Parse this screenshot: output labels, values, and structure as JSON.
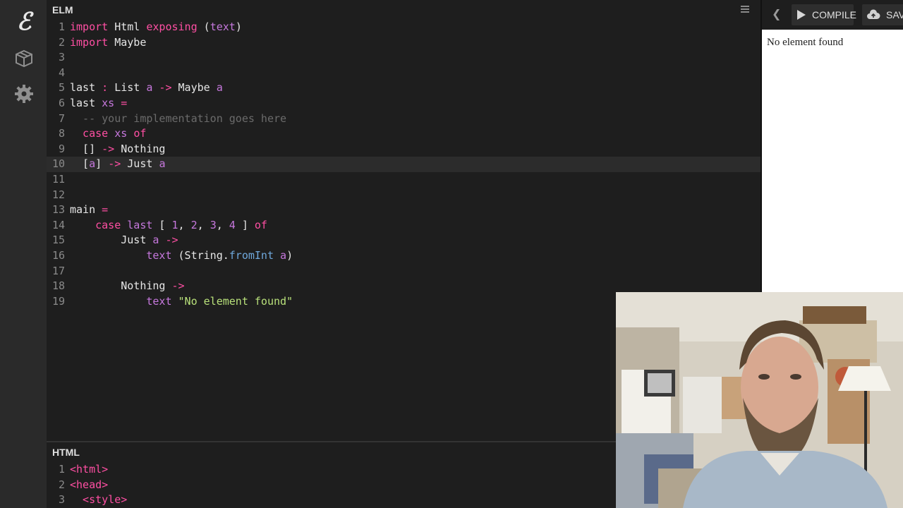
{
  "editor": {
    "title": "ELM",
    "lines": [
      {
        "n": "1",
        "tokens": [
          {
            "t": "import",
            "c": "kw"
          },
          {
            "t": " Html ",
            "c": "pl"
          },
          {
            "t": "exposing",
            "c": "kw"
          },
          {
            "t": " (",
            "c": "pl"
          },
          {
            "t": "text",
            "c": "tv"
          },
          {
            "t": ")",
            "c": "pl"
          }
        ]
      },
      {
        "n": "2",
        "tokens": [
          {
            "t": "import",
            "c": "kw"
          },
          {
            "t": " Maybe",
            "c": "pl"
          }
        ]
      },
      {
        "n": "3",
        "tokens": []
      },
      {
        "n": "4",
        "tokens": []
      },
      {
        "n": "5",
        "tokens": [
          {
            "t": "last",
            "c": "pl"
          },
          {
            "t": " : ",
            "c": "kw"
          },
          {
            "t": "List ",
            "c": "pl"
          },
          {
            "t": "a",
            "c": "tv"
          },
          {
            "t": " -> ",
            "c": "kw"
          },
          {
            "t": "Maybe ",
            "c": "pl"
          },
          {
            "t": "a",
            "c": "tv"
          }
        ]
      },
      {
        "n": "6",
        "tokens": [
          {
            "t": "last",
            "c": "pl"
          },
          {
            "t": " xs ",
            "c": "tv"
          },
          {
            "t": "=",
            "c": "kw"
          }
        ]
      },
      {
        "n": "7",
        "tokens": [
          {
            "t": "  -- your implementation goes here",
            "c": "cm"
          }
        ]
      },
      {
        "n": "8",
        "tokens": [
          {
            "t": "  case",
            "c": "kw"
          },
          {
            "t": " xs ",
            "c": "tv"
          },
          {
            "t": "of",
            "c": "kw"
          }
        ]
      },
      {
        "n": "9",
        "tokens": [
          {
            "t": "  [] ",
            "c": "pl"
          },
          {
            "t": "->",
            "c": "kw"
          },
          {
            "t": " Nothing",
            "c": "pl"
          }
        ]
      },
      {
        "n": "10",
        "active": true,
        "tokens": [
          {
            "t": "  [",
            "c": "pl"
          },
          {
            "t": "a",
            "c": "tv"
          },
          {
            "t": "] ",
            "c": "pl"
          },
          {
            "t": "->",
            "c": "kw"
          },
          {
            "t": " Just ",
            "c": "pl"
          },
          {
            "t": "a",
            "c": "tv"
          }
        ]
      },
      {
        "n": "11",
        "tokens": []
      },
      {
        "n": "12",
        "tokens": []
      },
      {
        "n": "13",
        "tokens": [
          {
            "t": "main ",
            "c": "pl"
          },
          {
            "t": "=",
            "c": "kw"
          }
        ]
      },
      {
        "n": "14",
        "tokens": [
          {
            "t": "    case",
            "c": "kw"
          },
          {
            "t": " last",
            "c": "tv"
          },
          {
            "t": " [ ",
            "c": "pl"
          },
          {
            "t": "1",
            "c": "nm"
          },
          {
            "t": ", ",
            "c": "pl"
          },
          {
            "t": "2",
            "c": "nm"
          },
          {
            "t": ", ",
            "c": "pl"
          },
          {
            "t": "3",
            "c": "nm"
          },
          {
            "t": ", ",
            "c": "pl"
          },
          {
            "t": "4",
            "c": "nm"
          },
          {
            "t": " ] ",
            "c": "pl"
          },
          {
            "t": "of",
            "c": "kw"
          }
        ]
      },
      {
        "n": "15",
        "tokens": [
          {
            "t": "        Just ",
            "c": "pl"
          },
          {
            "t": "a",
            "c": "tv"
          },
          {
            "t": " ->",
            "c": "kw"
          }
        ]
      },
      {
        "n": "16",
        "tokens": [
          {
            "t": "            text",
            "c": "tv"
          },
          {
            "t": " (String.",
            "c": "pl"
          },
          {
            "t": "fromInt",
            "c": "fn"
          },
          {
            "t": " ",
            "c": "pl"
          },
          {
            "t": "a",
            "c": "tv"
          },
          {
            "t": ")",
            "c": "pl"
          }
        ]
      },
      {
        "n": "17",
        "tokens": []
      },
      {
        "n": "18",
        "tokens": [
          {
            "t": "        Nothing ",
            "c": "pl"
          },
          {
            "t": "->",
            "c": "kw"
          }
        ]
      },
      {
        "n": "19",
        "tokens": [
          {
            "t": "            text",
            "c": "tv"
          },
          {
            "t": " \"No element found\"",
            "c": "st"
          }
        ]
      }
    ]
  },
  "html_panel": {
    "title": "HTML",
    "lines": [
      {
        "n": "1",
        "tokens": [
          {
            "t": "<html>",
            "c": "tag"
          }
        ]
      },
      {
        "n": "2",
        "tokens": [
          {
            "t": "<head>",
            "c": "tag"
          }
        ]
      },
      {
        "n": "3",
        "tokens": [
          {
            "t": "  <style>",
            "c": "tag"
          }
        ]
      }
    ]
  },
  "toolbar": {
    "back_icon": "chevron-left-icon",
    "compile_label": "COMPILE",
    "save_label": "SAV"
  },
  "preview": {
    "output_text": "No element found"
  },
  "rail_icons": [
    "elm-logo-icon",
    "package-icon",
    "gear-icon"
  ],
  "colors": {
    "background": "#1e1e1e",
    "keyword": "#ff4fa3",
    "variable": "#c678dd",
    "comment": "#6b6b6b",
    "string": "#b8e07a",
    "function": "#6fa8dc"
  }
}
